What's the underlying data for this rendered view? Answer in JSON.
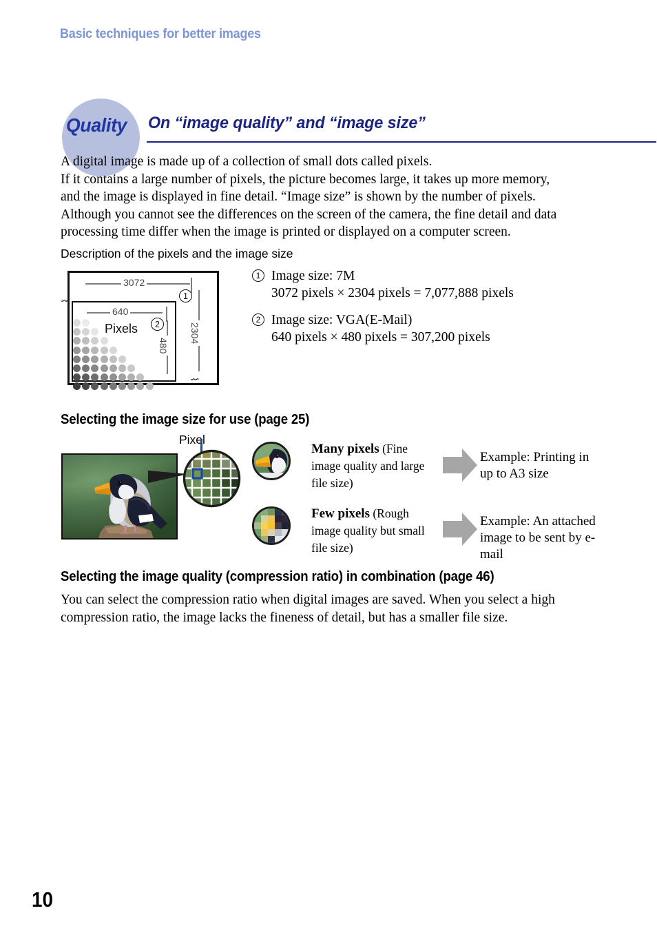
{
  "page": {
    "running_head": "Basic techniques for better images",
    "folio": "10"
  },
  "section": {
    "badge": "Quality",
    "badge_circle_color": "#b6bfdd",
    "badge_text_color": "#2135a3",
    "title": "On “image quality” and “image size”",
    "title_color": "#1a2380",
    "rule_color": "#1a2380"
  },
  "intro": {
    "line1": "A digital image is made up of a collection of small dots called pixels.",
    "line2": "If it contains a large number of pixels, the picture becomes large, it takes up more memory,",
    "line3": "and the image is displayed in fine detail. “Image size” is shown by the number of pixels.",
    "line4": "Although you cannot see the differences on the screen of the camera, the fine detail and data",
    "line5": "processing time differ when the image is printed or displayed on a computer screen."
  },
  "diagram": {
    "caption": "Description of the pixels and the image size",
    "outer_width_label": "3072",
    "outer_height_label": "2304",
    "inner_width_label": "640",
    "inner_height_label": "480",
    "pixels_label": "Pixels",
    "marker_outer": "1",
    "marker_inner": "2",
    "break_mark": "⌇"
  },
  "size_list": [
    {
      "marker": "1",
      "title": "Image size: 7M",
      "detail": "3072 pixels × 2304 pixels = 7,077,888 pixels"
    },
    {
      "marker": "2",
      "title": "Image size: VGA(E-Mail)",
      "detail": "640 pixels × 480 pixels = 307,200 pixels"
    }
  ],
  "size_section": {
    "heading": "Selecting the image size for use (page 25)",
    "pixel_callout": "Pixel",
    "rows": [
      {
        "label_bold": "Many pixels",
        "label_rest": " (Fine image quality and large file size)",
        "example": "Example: Printing in up to A3 size"
      },
      {
        "label_bold": "Few pixels",
        "label_rest": " (Rough image quality but small file size)",
        "example": "Example: An attached image to be sent by e-mail"
      }
    ],
    "arrow_color": "#a6a6a6"
  },
  "quality_section": {
    "heading": "Selecting the image quality (compression ratio) in combination (page 46)",
    "line1": "You can select the compression ratio when digital images are saved. When you select a high",
    "line2": "compression ratio, the image lacks the fineness of detail, but has a smaller file size."
  }
}
